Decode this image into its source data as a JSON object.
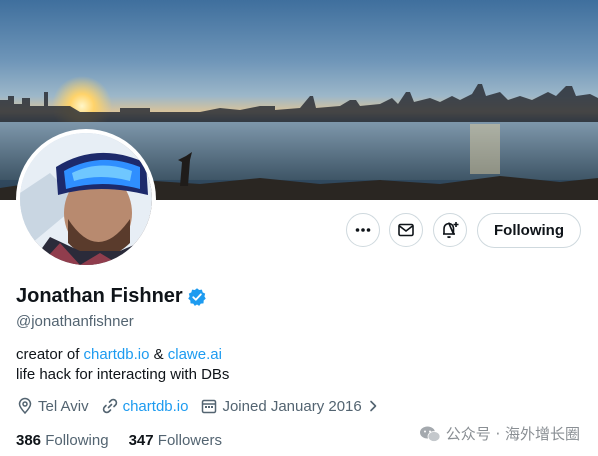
{
  "profile": {
    "name": "Jonathan Fishner",
    "handle": "@jonathanfishner",
    "bio_line1_prefix": "creator of ",
    "bio_link1": "chartdb.io",
    "bio_amp": " & ",
    "bio_link2": "clawe.ai",
    "bio_line2": "life hack for interacting with DBs",
    "location": "Tel Aviv",
    "website": "chartdb.io",
    "joined": "Joined January 2016",
    "following_count": "386",
    "following_label": "Following",
    "followers_count": "347",
    "followers_label": "Followers"
  },
  "actions": {
    "more_icon": "more-icon",
    "message_icon": "mail-icon",
    "notify_icon": "bell-plus-icon",
    "follow_label": "Following"
  },
  "watermark": {
    "text": "公众号 · 海外增长圈"
  },
  "colors": {
    "link": "#1d9bf0",
    "secondary_text": "#536471",
    "verified": "#1d9bf0"
  }
}
